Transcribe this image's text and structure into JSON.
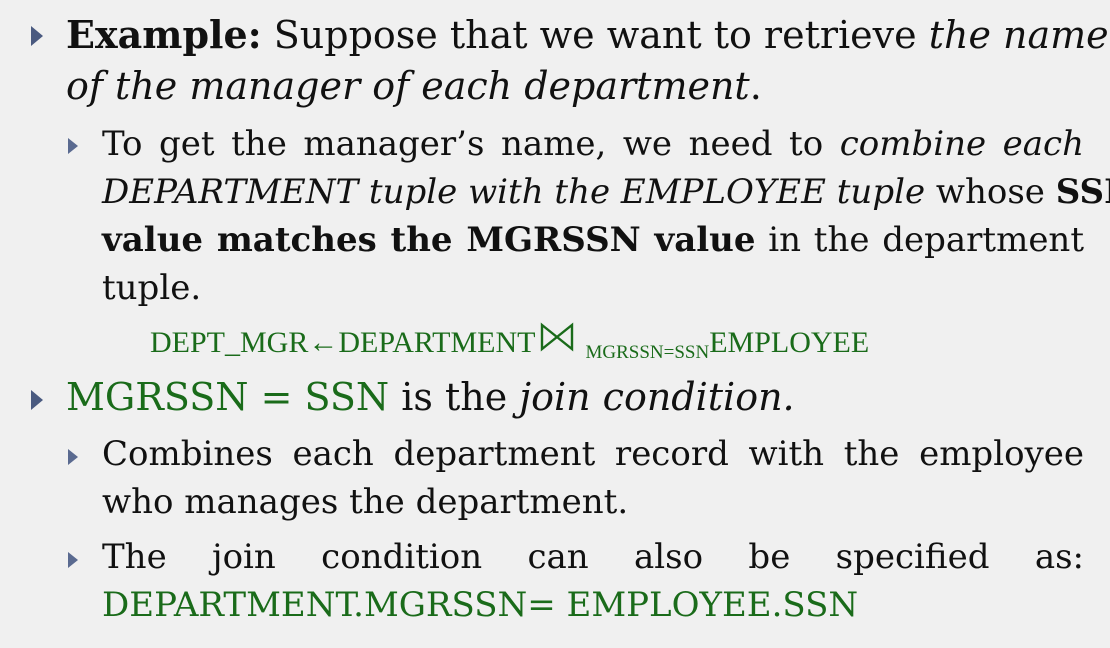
{
  "example": {
    "label": "Example:",
    "text_plain": " Suppose that we want to retrieve ",
    "text_italic": "the name",
    "line2_italic": "of the manager of each department",
    "line2_end": "."
  },
  "sub1": {
    "l1_plain": "To get the manager’s name, we need to ",
    "l1_italic": "combine each",
    "l2_italic": "DEPARTMENT tuple with the EMPLOYEE tuple",
    "l2_plain": " whose ",
    "l2_bold": "SSN",
    "l3_bold": "value matches the MGRSSN value",
    "l3_plain": " in the department",
    "l4_plain": "tuple."
  },
  "formula": {
    "left": "DEPT_MGR←DEPARTMENT",
    "join_symbol": "⋈",
    "subscript": "MGRSSN=SSN",
    "right": "EMPLOYEE"
  },
  "point2": {
    "green": "MGRSSN = SSN",
    "plain": " is the ",
    "italic": "join condition."
  },
  "sub2": {
    "l1": "Combines each department record with the employee",
    "l2": "who manages the department."
  },
  "sub3": {
    "l1": "The join condition can also be specified as:",
    "l2_green": "DEPARTMENT.MGRSSN= EMPLOYEE.SSN"
  },
  "colors": {
    "background": "#f0f0f0",
    "text": "#111111",
    "accent_green": "#1a6b1a",
    "bullet": "#4a5a80"
  }
}
